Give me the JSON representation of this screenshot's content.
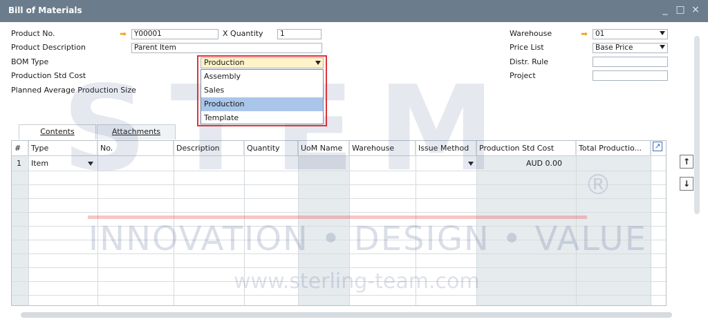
{
  "window": {
    "title": "Bill of Materials",
    "minimize_glyph": "_",
    "maximize_glyph": "□",
    "close_glyph": "×"
  },
  "header": {
    "product_no_label": "Product No.",
    "product_no_value": "Y00001",
    "quantity_label": "X Quantity",
    "quantity_value": "1",
    "product_desc_label": "Product Description",
    "product_desc_value": "Parent Item",
    "bom_type_label": "BOM Type",
    "bom_type_value": "Production",
    "prod_std_cost_label": "Production Std Cost",
    "planned_avg_label": "Planned Average Production Size",
    "warehouse_label": "Warehouse",
    "warehouse_value": "01",
    "price_list_label": "Price List",
    "price_list_value": "Base Price",
    "distr_rule_label": "Distr. Rule",
    "distr_rule_value": "",
    "project_label": "Project",
    "project_value": ""
  },
  "bom_type_options": [
    "Assembly",
    "Sales",
    "Production",
    "Template"
  ],
  "bom_type_selected_index": 2,
  "tabs": [
    {
      "label": "Contents",
      "active": true
    },
    {
      "label": "Attachments",
      "active": false
    }
  ],
  "grid": {
    "columns": [
      "#",
      "Type",
      "No.",
      "Description",
      "Quantity",
      "UoM Name",
      "Warehouse",
      "Issue Method",
      "Production Std Cost",
      "Total Productio..."
    ],
    "rows": [
      {
        "num": "1",
        "type": "Item",
        "no": "",
        "description": "",
        "quantity": "",
        "uom": "",
        "warehouse": "",
        "issue_method": "",
        "prod_std_cost": "AUD 0.00",
        "total": ""
      }
    ]
  },
  "side_buttons": {
    "up": "↑",
    "down": "↓"
  },
  "watermark": {
    "brand": "STEM",
    "registered": "®",
    "tagline": "INNOVATION • DESIGN • VALUE",
    "url": "www.sterling-team.com"
  },
  "colors": {
    "titlebar": "#6b7d8c",
    "highlight": "#e0313a",
    "selected_option": "#a9c6ea",
    "link_arrow": "#f2a31a"
  }
}
